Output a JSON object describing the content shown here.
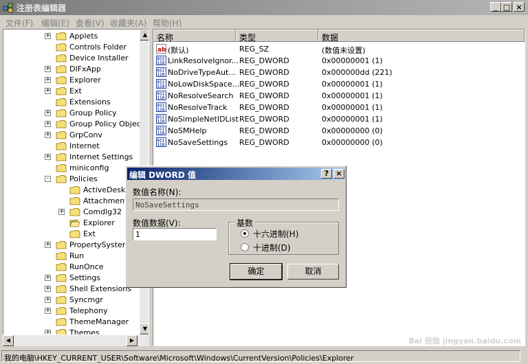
{
  "window": {
    "title": "注册表编辑器",
    "controls": [
      "_",
      "□",
      "×"
    ]
  },
  "menu": [
    {
      "label": "文件(F)"
    },
    {
      "label": "编辑(E)"
    },
    {
      "label": "查看(V)"
    },
    {
      "label": "收藏夹(A)"
    },
    {
      "label": "帮助(H)"
    }
  ],
  "tree": {
    "items": [
      {
        "label": "Applets",
        "expander": "+"
      },
      {
        "label": "Controls Folder",
        "expander": ""
      },
      {
        "label": "Device Installer",
        "expander": ""
      },
      {
        "label": "DIFxApp",
        "expander": "+"
      },
      {
        "label": "Explorer",
        "expander": "+"
      },
      {
        "label": "Ext",
        "expander": "+"
      },
      {
        "label": "Extensions",
        "expander": ""
      },
      {
        "label": "Group Policy",
        "expander": "+"
      },
      {
        "label": "Group Policy Objects",
        "expander": "+"
      },
      {
        "label": "GrpConv",
        "expander": "+"
      },
      {
        "label": "Internet",
        "expander": ""
      },
      {
        "label": "Internet Settings",
        "expander": "+"
      },
      {
        "label": "miniconfig",
        "expander": ""
      },
      {
        "label": "Policies",
        "expander": "-"
      },
      {
        "label": "ActiveDesktop",
        "expander": "",
        "child": true
      },
      {
        "label": "Attachments",
        "expander": "",
        "child": true
      },
      {
        "label": "Comdlg32",
        "expander": "+",
        "child": true
      },
      {
        "label": "Explorer",
        "expander": "",
        "child": true,
        "open": true
      },
      {
        "label": "Ext",
        "expander": "",
        "child": true
      },
      {
        "label": "PropertySystem",
        "expander": "+"
      },
      {
        "label": "Run",
        "expander": ""
      },
      {
        "label": "RunOnce",
        "expander": ""
      },
      {
        "label": "Settings",
        "expander": "+"
      },
      {
        "label": "Shell Extensions",
        "expander": "+"
      },
      {
        "label": "Syncmgr",
        "expander": "+"
      },
      {
        "label": "Telephony",
        "expander": "+"
      },
      {
        "label": "ThemeManager",
        "expander": ""
      },
      {
        "label": "Themes",
        "expander": "+"
      }
    ]
  },
  "list": {
    "columns": [
      "名称",
      "类型",
      "数据"
    ],
    "rows": [
      {
        "icon": "ab",
        "name": "(默认)",
        "type": "REG_SZ",
        "data": "(数值未设置)"
      },
      {
        "icon": "bin",
        "name": "LinkResolveIgnor...",
        "type": "REG_DWORD",
        "data": "0x00000001 (1)"
      },
      {
        "icon": "bin",
        "name": "NoDriveTypeAut...",
        "type": "REG_DWORD",
        "data": "0x000000dd (221)"
      },
      {
        "icon": "bin",
        "name": "NoLowDiskSpace...",
        "type": "REG_DWORD",
        "data": "0x00000001 (1)"
      },
      {
        "icon": "bin",
        "name": "NoResolveSearch",
        "type": "REG_DWORD",
        "data": "0x00000001 (1)"
      },
      {
        "icon": "bin",
        "name": "NoResolveTrack",
        "type": "REG_DWORD",
        "data": "0x00000001 (1)"
      },
      {
        "icon": "bin",
        "name": "NoSimpleNetIDList",
        "type": "REG_DWORD",
        "data": "0x00000001 (1)"
      },
      {
        "icon": "bin",
        "name": "NoSMHelp",
        "type": "REG_DWORD",
        "data": "0x00000000 (0)"
      },
      {
        "icon": "bin",
        "name": "NoSaveSettings",
        "type": "REG_DWORD",
        "data": "0x00000000 (0)"
      }
    ]
  },
  "dialog": {
    "title": "编辑 DWORD 值",
    "help": "?",
    "close": "×",
    "value_name_label": "数值名称(N):",
    "value_name": "NoSaveSettings",
    "value_data_label": "数值数据(V):",
    "value_data": "1",
    "base_label": "基数",
    "hex_label": "十六进制(H)",
    "dec_label": "十进制(D)",
    "ok": "确定",
    "cancel": "取消"
  },
  "status": {
    "path": "我的电脑\\HKEY_CURRENT_USER\\Software\\Microsoft\\Windows\\CurrentVersion\\Policies\\Explorer"
  },
  "watermark": "Bai 经验 jingyan.baidu.com"
}
